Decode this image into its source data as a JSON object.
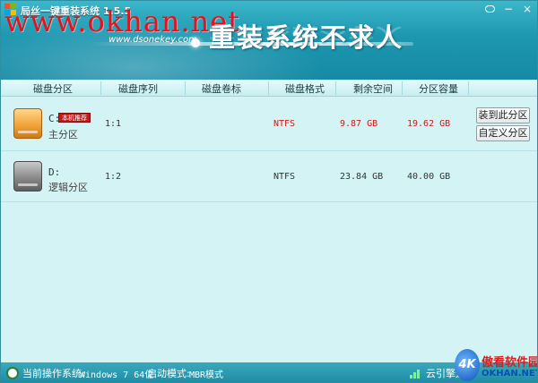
{
  "window": {
    "title": "局丝一键重装系统 1.5.5",
    "watermark": "www.okhan.net",
    "site_url": "www.dsonekey.com",
    "slogan": "重装系统不求人",
    "controls": {
      "minimize": "−",
      "close": "×"
    }
  },
  "columns": [
    "磁盘分区",
    "磁盘序列",
    "磁盘卷标",
    "磁盘格式",
    "剩余空间",
    "分区容量"
  ],
  "partitions": [
    {
      "drive": "C:",
      "badge": "本机推荐",
      "type": "主分区",
      "sequence": "1:1",
      "label": "",
      "format": "NTFS",
      "free": "9.87 GB",
      "capacity": "19.62 GB",
      "icon": "orange-hard-drive-icon"
    },
    {
      "drive": "D:",
      "type": "逻辑分区",
      "sequence": "1:2",
      "label": "",
      "format": "NTFS",
      "free": "23.84 GB",
      "capacity": "40.00 GB",
      "icon": "gray-hard-drive-icon"
    }
  ],
  "actions": {
    "install_here": "装到此分区",
    "custom_partition": "自定义分区"
  },
  "status": {
    "os_label": "当前操作系统:",
    "os_value": "Windows 7 64位",
    "boot_label": "启动模式:",
    "boot_value": "MBR模式",
    "engine_label": "云引擎运"
  },
  "corner_logo": {
    "k": "4K",
    "cn": "傲看软件园",
    "en": "OKHAN.NET"
  },
  "colors": {
    "banner": "#1d97b0",
    "accent_red": "#d21818",
    "badge_red": "#c41a1a",
    "status_bar": "#1d8aa2"
  }
}
